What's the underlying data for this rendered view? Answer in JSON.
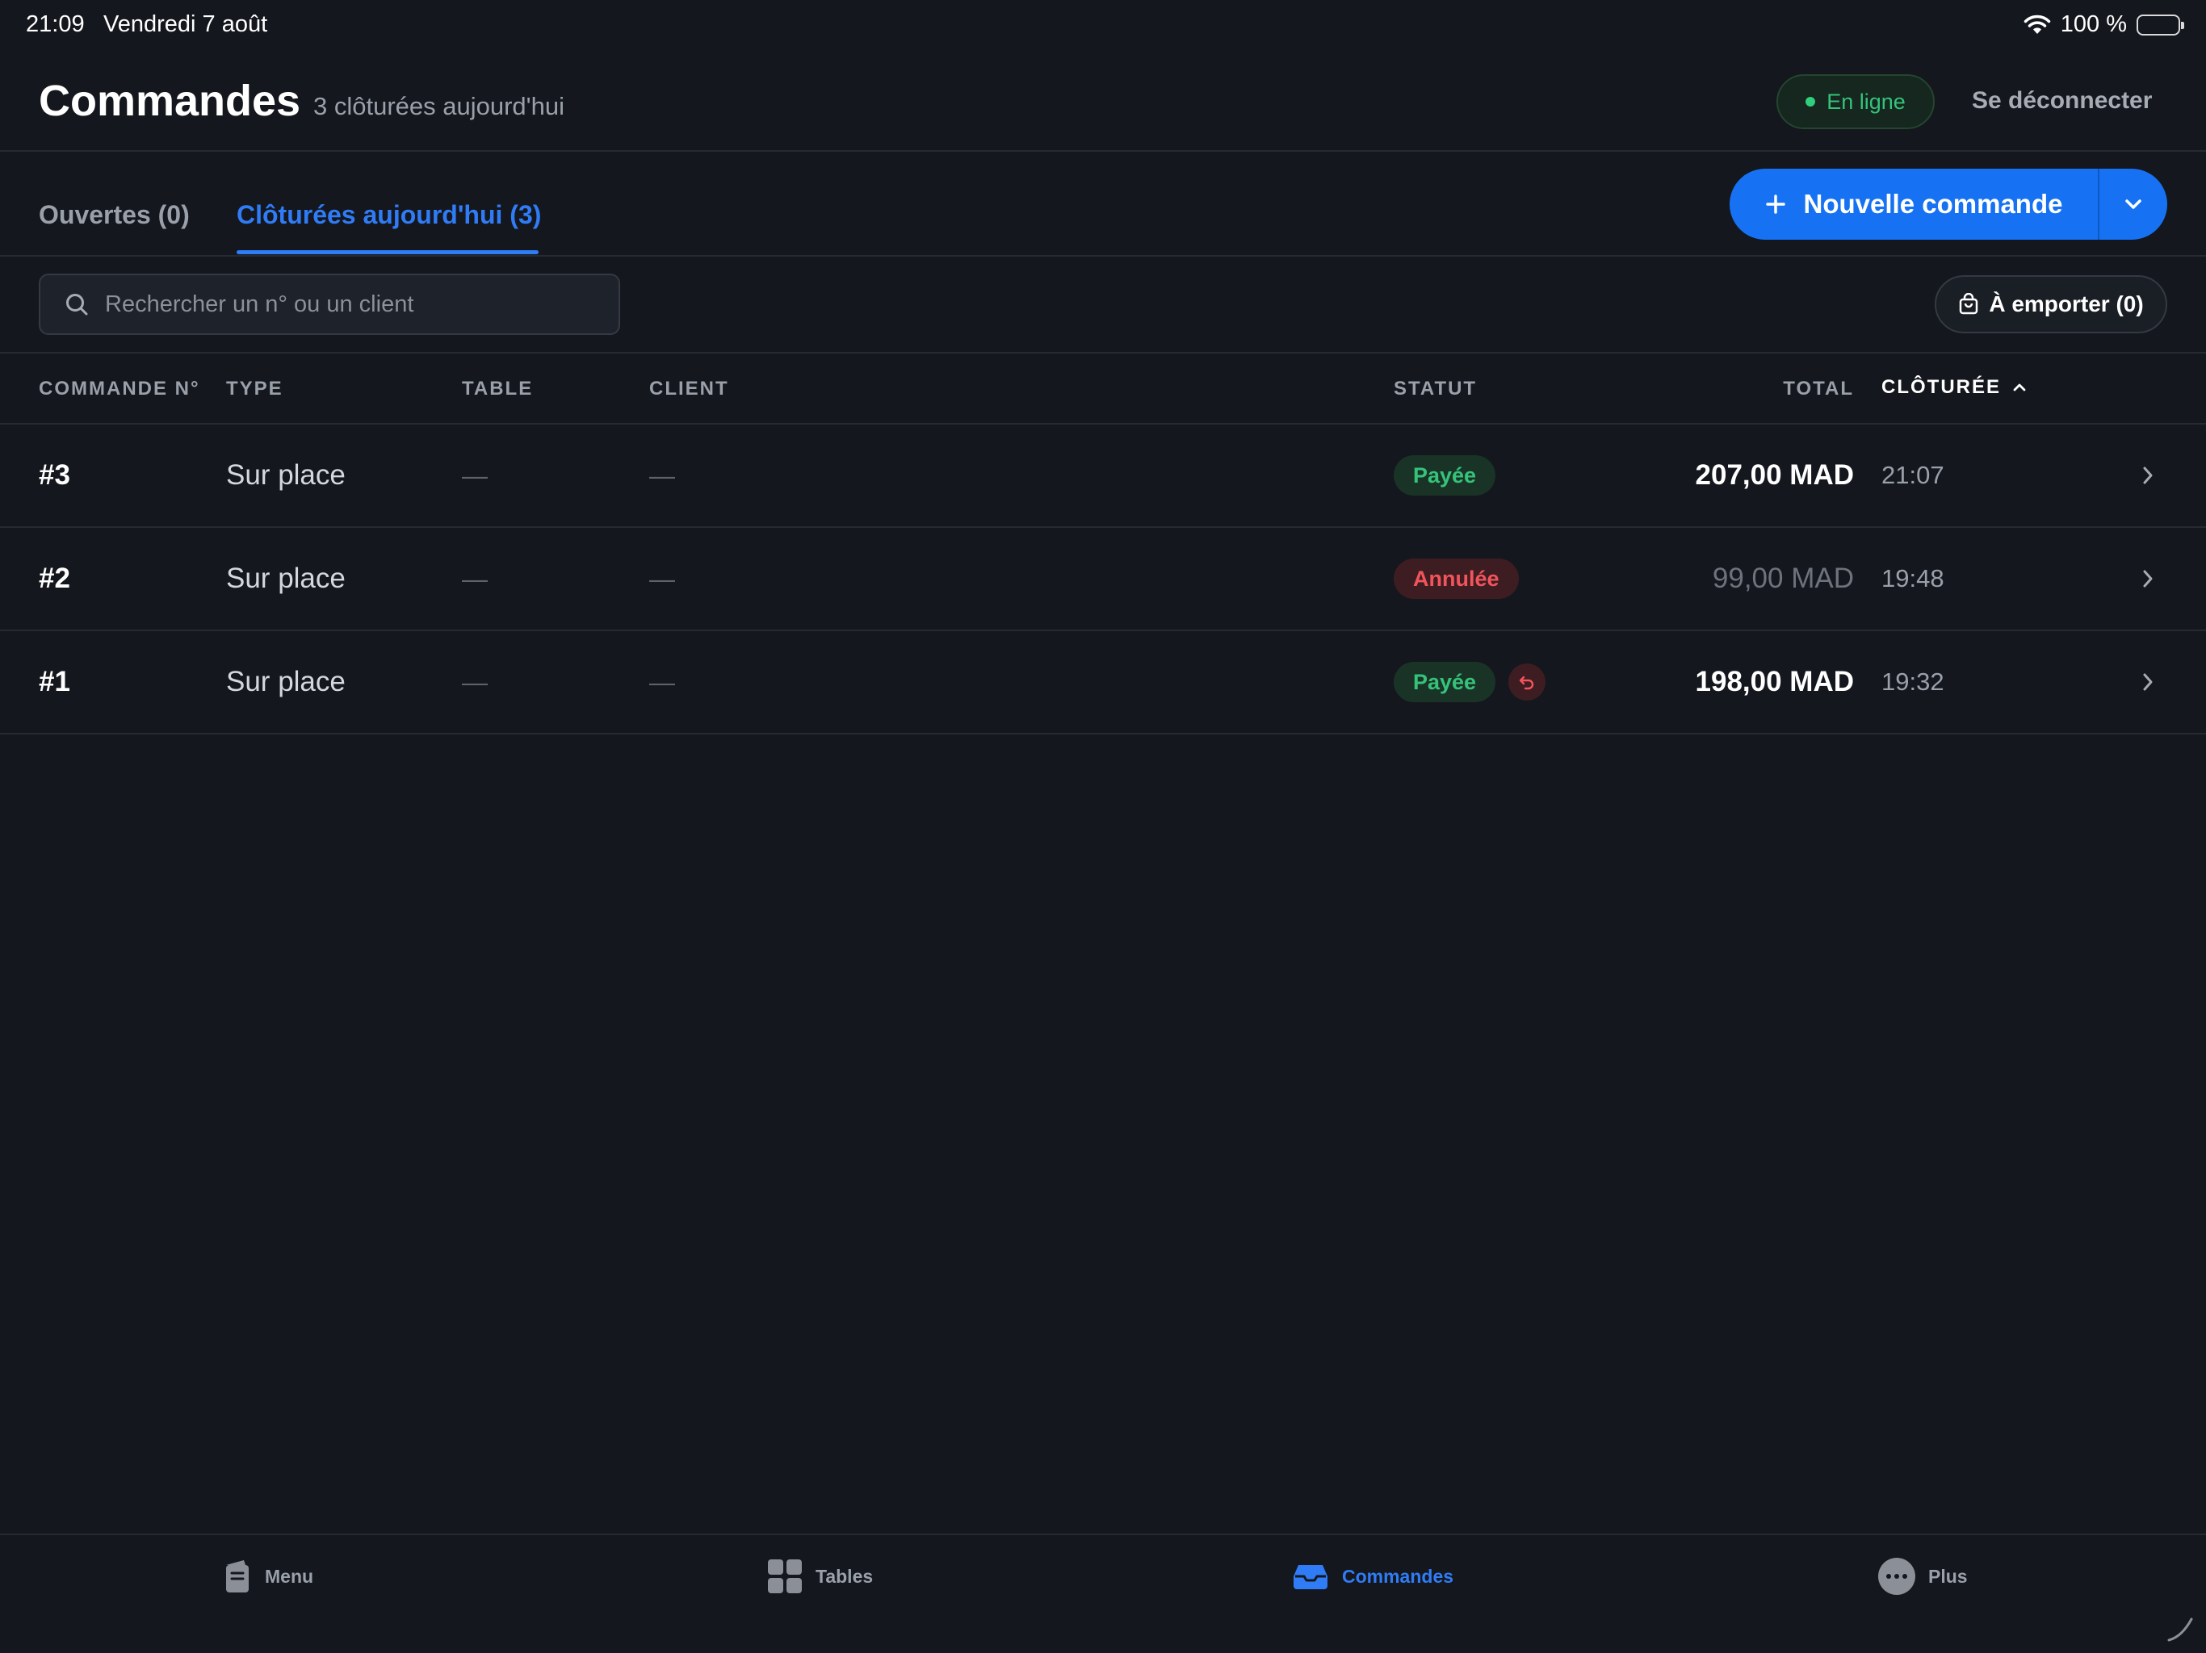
{
  "status_bar": {
    "time": "21:09",
    "date": "Vendredi 7 août",
    "battery": "100 %"
  },
  "header": {
    "title": "Commandes",
    "subtitle": "3 clôturées aujourd'hui",
    "online_label": "En ligne",
    "logout_label": "Se déconnecter"
  },
  "tabs": [
    {
      "label": "Ouvertes (0)",
      "active": false
    },
    {
      "label": "Clôturées aujourd'hui (3)",
      "active": true
    }
  ],
  "new_order": {
    "label": "Nouvelle commande"
  },
  "search": {
    "placeholder": "Rechercher un n° ou un client",
    "value": ""
  },
  "takeaway": {
    "label": "À emporter (0)"
  },
  "table": {
    "columns": {
      "number": "COMMANDE N°",
      "type": "TYPE",
      "table": "TABLE",
      "client": "CLIENT",
      "status": "STATUT",
      "total": "TOTAL",
      "closed": "CLÔTURÉE"
    },
    "sort": {
      "column": "closed",
      "direction": "asc"
    },
    "rows": [
      {
        "number": "#3",
        "type": "Sur place",
        "table": "—",
        "client": "—",
        "status": "Payée",
        "status_kind": "paid",
        "refund": false,
        "total": "207,00 MAD",
        "closed": "21:07"
      },
      {
        "number": "#2",
        "type": "Sur place",
        "table": "—",
        "client": "—",
        "status": "Annulée",
        "status_kind": "cancelled",
        "refund": false,
        "total": "99,00 MAD",
        "closed": "19:48"
      },
      {
        "number": "#1",
        "type": "Sur place",
        "table": "—",
        "client": "—",
        "status": "Payée",
        "status_kind": "paid",
        "refund": true,
        "total": "198,00 MAD",
        "closed": "19:32"
      }
    ]
  },
  "bottom_nav": [
    {
      "label": "Menu",
      "icon": "menu-book-icon",
      "active": false
    },
    {
      "label": "Tables",
      "icon": "grid-icon",
      "active": false
    },
    {
      "label": "Commandes",
      "icon": "inbox-tray-icon",
      "active": true
    },
    {
      "label": "Plus",
      "icon": "more-icon",
      "active": false,
      "notification": true
    }
  ],
  "colors": {
    "background": "#14171d",
    "accent": "#1672f3",
    "success": "#35c37a",
    "danger": "#f2545b"
  }
}
